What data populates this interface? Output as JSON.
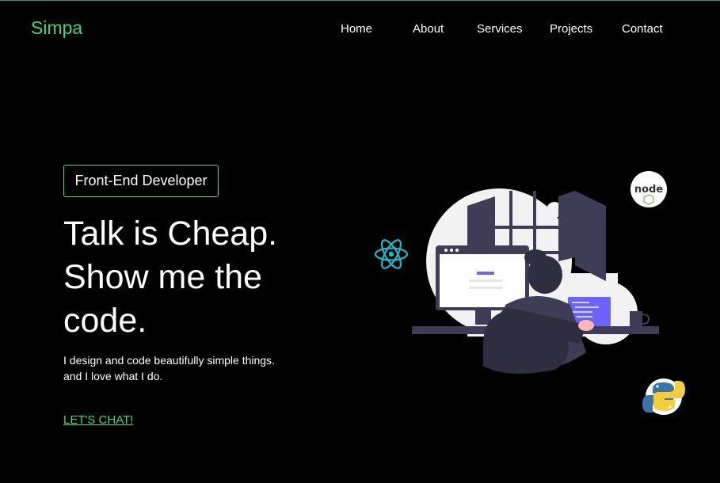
{
  "brand": {
    "name": "Simpa",
    "accent_color": "#3fd783"
  },
  "nav": {
    "items": [
      {
        "label": "Home"
      },
      {
        "label": "About"
      },
      {
        "label": "Services"
      },
      {
        "label": "Projects"
      },
      {
        "label": "Contact"
      }
    ]
  },
  "hero": {
    "role_badge": "Front-End Developer",
    "headline_lines": [
      "Talk is Cheap.",
      "Show me the",
      "code."
    ],
    "intro_lines": [
      "I design and code beautifully simple things.",
      "and I love what I do."
    ],
    "cta_label": "LET'S CHAT!"
  },
  "illustration": {
    "icons": [
      "react-logo-icon",
      "nodejs-logo-icon",
      "python-logo-icon"
    ],
    "colors": {
      "figure": "#3f3d56",
      "accent": "#6c63ff",
      "react": "#1fb8c8",
      "python_blue": "#3b75a8",
      "python_yellow": "#f4ce3b"
    }
  }
}
